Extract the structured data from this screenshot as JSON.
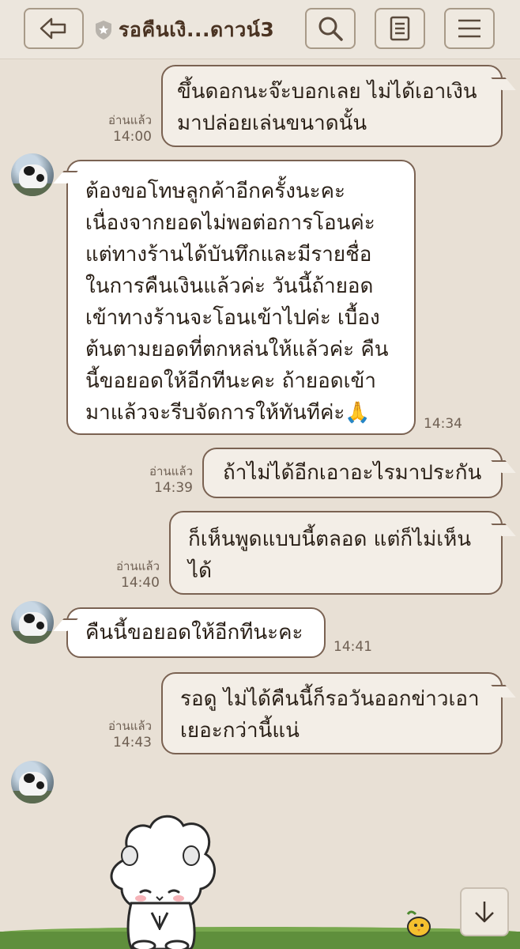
{
  "header": {
    "title": "รอคืนเงิ...ดาวน์3",
    "icons": [
      "back-arrow-icon",
      "shield-star-icon",
      "search-icon",
      "note-icon",
      "menu-icon"
    ]
  },
  "messages": [
    {
      "dir": "out",
      "lines": [
        "ขึ้นดอกนะจ๊ะบอกเลย ไม่ได้เอาเงิน",
        "มาปล่อยเล่นขนาดนั้น"
      ],
      "read": "อ่านแล้ว",
      "time": "14:00"
    },
    {
      "dir": "in",
      "lines": [
        "ต้องขอโทษลูกค้าอีกครั้งนะคะ",
        "เนื่องจากยอดไม่พอต่อการโอนค่ะ",
        "แต่ทางร้านได้บันทึกและมีรายชื่อ",
        "ในการคืนเงินแล้วค่ะ วันนี้ถ้ายอด",
        "เข้าทางร้านจะโอนเข้าไปค่ะ เบื้อง",
        "ต้นตามยอดที่ตกหล่นให้แล้วค่ะ คืน",
        "นี้ขอยอดให้อีกทีนะคะ ถ้ายอดเข้า",
        "มาแล้วจะรีบจัดการให้ทันทีค่ะ🙏"
      ],
      "time": "14:34"
    },
    {
      "dir": "out",
      "lines": [
        "ถ้าไม่ได้อีกเอาอะไรมาประกัน"
      ],
      "read": "อ่านแล้ว",
      "time": "14:39"
    },
    {
      "dir": "out",
      "lines": [
        "ก็เห็นพูดแบบนี้ตลอด แต่ก็ไม่เห็น",
        "ได้"
      ],
      "read": "อ่านแล้ว",
      "time": "14:40"
    },
    {
      "dir": "in",
      "lines": [
        "คืนนี้ขอยอดให้อีกทีนะคะ"
      ],
      "time": "14:41"
    },
    {
      "dir": "out",
      "lines": [
        "รอดู ไม่ได้คืนนี้ก็รอวันออกข่าวเอา",
        "เยอะกว่านี้แน่"
      ],
      "read": "อ่านแล้ว",
      "time": "14:43"
    }
  ],
  "sticker": {
    "icon": "bowing-sheep-sticker-icon"
  },
  "scroll_button": {
    "icon": "arrow-down-icon"
  }
}
